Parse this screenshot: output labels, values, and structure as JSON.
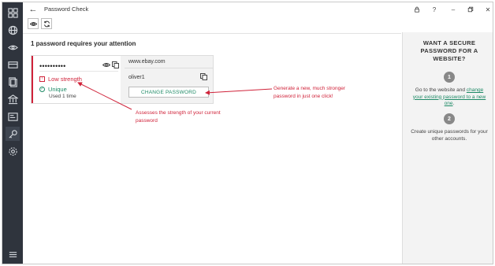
{
  "window": {
    "title": "Password Check",
    "controls": [
      "lock-icon",
      "help",
      "minimize",
      "restore",
      "close"
    ],
    "help_label": "?",
    "minimize_label": "–",
    "restore_label": "🗗",
    "close_label": "✕"
  },
  "nav": {
    "items": [
      "dashboard-icon",
      "globe-icon",
      "eye-icon",
      "card-icon",
      "documents-icon",
      "bank-icon",
      "id-card-icon",
      "key-icon",
      "settings-icon"
    ],
    "menu_icon": "hamburger-icon"
  },
  "toolbar": {
    "buttons": [
      "eye-icon",
      "refresh-icon"
    ]
  },
  "main": {
    "heading": "1 password requires your attention",
    "card": {
      "masked_password": "••••••••••",
      "strength_label": "Low strength",
      "unique_label": "Unique",
      "used_label": "Used 1 time",
      "site": "www.ebay.com",
      "username": "oliver1",
      "change_button": "CHANGE PASSWORD"
    }
  },
  "annotations": {
    "right_line1": "Generate a new, much stronger",
    "right_line2": "password in just one click!",
    "bottom_line1": "Assesses the strength of your current",
    "bottom_line2": "password"
  },
  "side_panel": {
    "heading_line1": "WANT A SECURE",
    "heading_line2": "PASSWORD FOR A",
    "heading_line3": "WEBSITE?",
    "step1_number": "1",
    "step1_text_prefix": "Go to the website and",
    "step1_link": "change your existing password to a new one",
    "step1_suffix": ".",
    "step2_number": "2",
    "step2_text": "Create unique passwords for your other accounts."
  },
  "colors": {
    "nav_bg": "#2f343d",
    "alert_red": "#d0233a",
    "accent_green": "#1e8a66",
    "panel_bg": "#f3f3f3"
  }
}
